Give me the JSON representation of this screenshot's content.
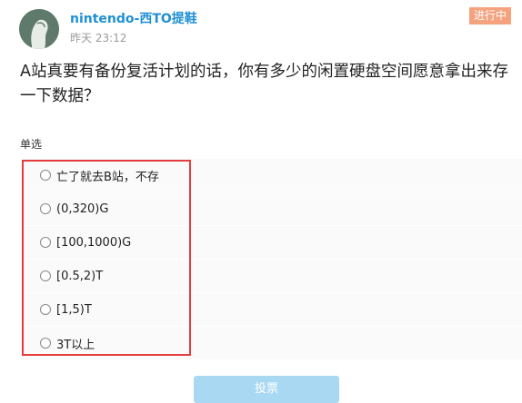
{
  "post": {
    "username": "nintendo-西TO提鞋",
    "timestamp": "昨天 23:12",
    "status": "进行中"
  },
  "question": "A站真要有备份复活计划的话，你有多少的闲置硬盘空间愿意拿出来存一下数据？",
  "poll": {
    "type_label": "单选",
    "options": [
      {
        "label": "亡了就去B站，不存"
      },
      {
        "label": "(0,320)G"
      },
      {
        "label": "[100,1000)G"
      },
      {
        "label": "[0.5,2)T"
      },
      {
        "label": "[1,5)T"
      },
      {
        "label": "3T以上"
      }
    ],
    "vote_label": "投票"
  },
  "colors": {
    "username": "#1f8fd6",
    "status_badge": "#f5a27f",
    "vote_button": "#a9d8f2",
    "highlight": "#e53d3d"
  }
}
